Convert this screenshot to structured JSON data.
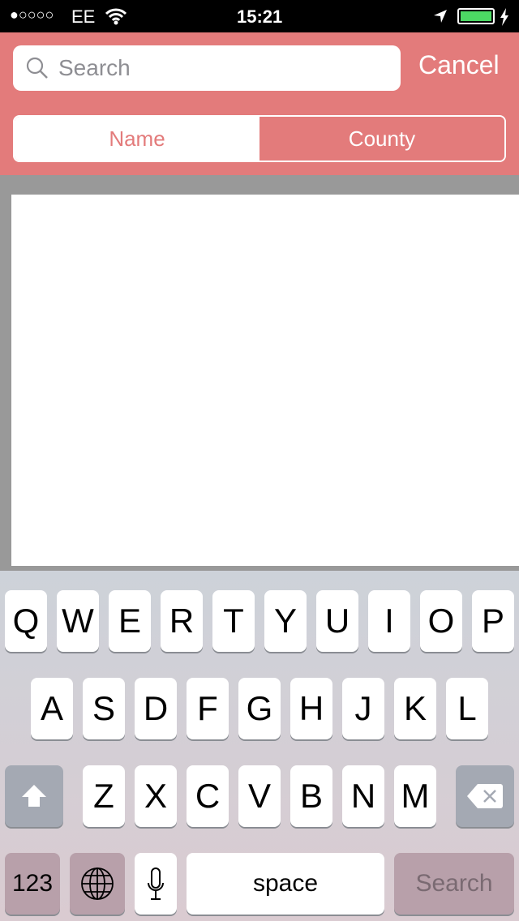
{
  "status": {
    "signal": "●○○○○",
    "carrier": "EE",
    "time": "15:21",
    "battery_level": 1.0,
    "battery_color": "#4cd964"
  },
  "search": {
    "placeholder": "Search",
    "cancel": "Cancel"
  },
  "segments": {
    "items": [
      "Name",
      "County"
    ],
    "selected": "Name"
  },
  "colors": {
    "accent": "#e37b7b"
  },
  "keyboard": {
    "row1": [
      "Q",
      "W",
      "E",
      "R",
      "T",
      "Y",
      "U",
      "I",
      "O",
      "P"
    ],
    "row2": [
      "A",
      "S",
      "D",
      "F",
      "G",
      "H",
      "J",
      "K",
      "L"
    ],
    "row3": [
      "Z",
      "X",
      "C",
      "V",
      "B",
      "N",
      "M"
    ],
    "numbers": "123",
    "space": "space",
    "action": "Search"
  }
}
